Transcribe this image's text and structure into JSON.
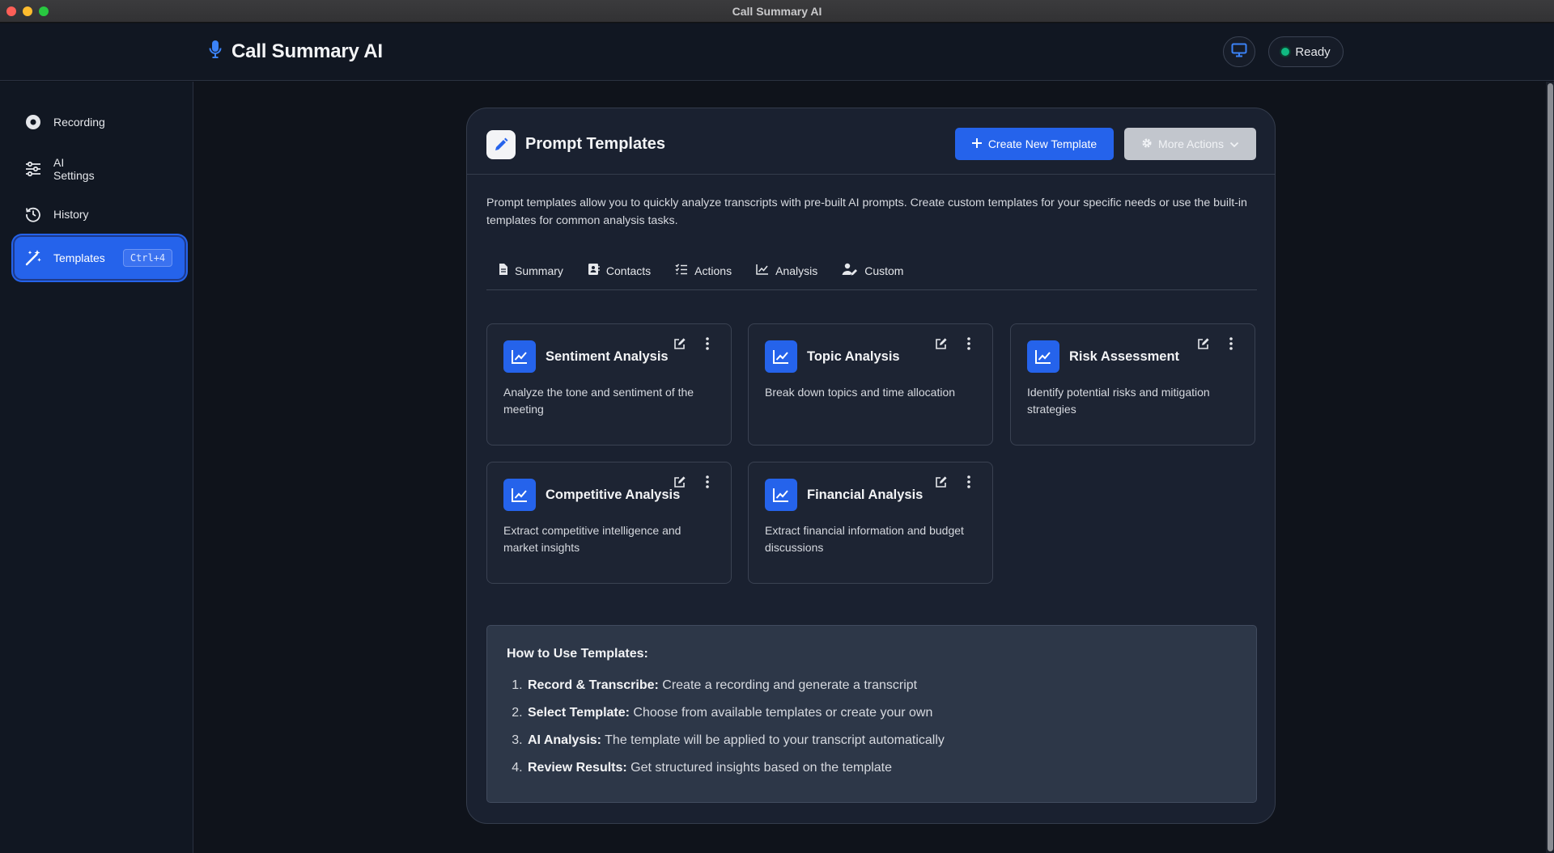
{
  "window": {
    "title": "Call Summary AI"
  },
  "header": {
    "brand_title": "Call Summary AI",
    "status_label": "Ready"
  },
  "sidebar": {
    "items": [
      {
        "label": "Recording",
        "icon": "record-icon"
      },
      {
        "label": "AI\nSettings",
        "icon": "sliders-icon"
      },
      {
        "label": "History",
        "icon": "history-icon"
      },
      {
        "label": "Templates",
        "icon": "magic-wand-icon",
        "shortcut": "Ctrl+4",
        "active": true
      }
    ]
  },
  "main": {
    "title": "Prompt Templates",
    "create_button": "Create New Template",
    "more_button": "More Actions",
    "description": "Prompt templates allow you to quickly analyze transcripts with pre-built AI prompts. Create custom templates for your specific needs or use the built-in templates for common analysis tasks.",
    "tabs": [
      {
        "label": "Summary",
        "icon": "document-icon"
      },
      {
        "label": "Contacts",
        "icon": "contact-card-icon"
      },
      {
        "label": "Actions",
        "icon": "checklist-icon"
      },
      {
        "label": "Analysis",
        "icon": "line-chart-icon"
      },
      {
        "label": "Custom",
        "icon": "user-edit-icon"
      }
    ],
    "templates": [
      {
        "title": "Sentiment Analysis",
        "description": "Analyze the tone and sentiment of the meeting"
      },
      {
        "title": "Topic Analysis",
        "description": "Break down topics and time allocation"
      },
      {
        "title": "Risk Assessment",
        "description": "Identify potential risks and mitigation strategies"
      },
      {
        "title": "Competitive Analysis",
        "description": "Extract competitive intelligence and market insights"
      },
      {
        "title": "Financial Analysis",
        "description": "Extract financial information and budget discussions"
      }
    ],
    "howto": {
      "title": "How to Use Templates:",
      "steps": [
        {
          "bold": "Record & Transcribe:",
          "text": " Create a recording and generate a transcript"
        },
        {
          "bold": "Select Template:",
          "text": " Choose from available templates or create your own"
        },
        {
          "bold": "AI Analysis:",
          "text": " The template will be applied to your transcript automatically"
        },
        {
          "bold": "Review Results:",
          "text": " Get structured insights based on the template"
        }
      ]
    }
  },
  "colors": {
    "accent": "#2563eb",
    "background": "#0f131b",
    "card": "#1a2130",
    "status_ready": "#10b981"
  }
}
